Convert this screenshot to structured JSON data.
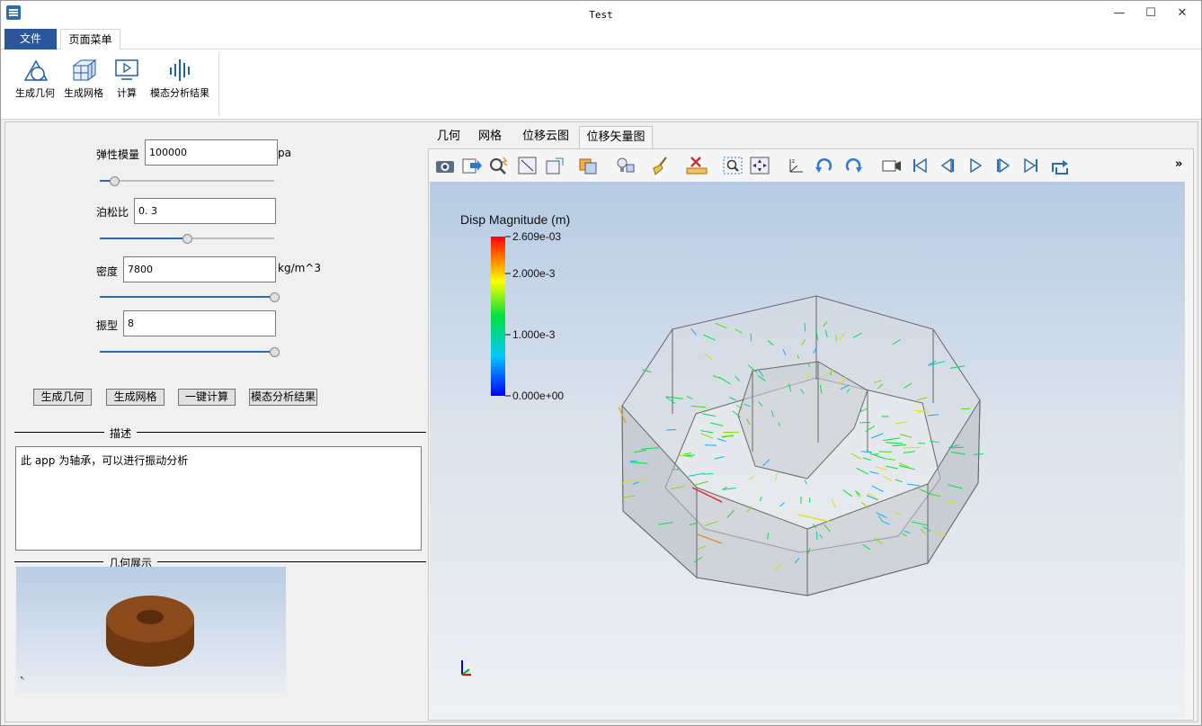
{
  "window": {
    "title": "Test",
    "minimize": "—",
    "maximize": "☐",
    "close": "✕"
  },
  "ribbon": {
    "tabs": [
      "文件",
      "页面菜单"
    ],
    "buttons": [
      "生成几何",
      "生成网格",
      "计算",
      "模态分析结果"
    ]
  },
  "params": {
    "elastic": {
      "label": "弹性模量",
      "value": "100000",
      "unit": "pa",
      "slider": 0.08
    },
    "poisson": {
      "label": "泊松比",
      "value": "0. 3",
      "slider": 0.5
    },
    "density": {
      "label": "密度",
      "value": "7800",
      "unit": "kg/m^3",
      "slider": 1.0
    },
    "mode": {
      "label": "振型",
      "value": "8",
      "slider": 1.0
    }
  },
  "actions": [
    "生成几何",
    "生成网格",
    "一键计算",
    "模态分析结果"
  ],
  "description": {
    "title": "描述",
    "text": "此 app 为轴承，可以进行振动分析"
  },
  "geometry_preview": {
    "title": "几何展示",
    "color": "#8a4a1a"
  },
  "view_tabs": [
    "几何",
    "网格",
    "位移云图",
    "位移矢量图"
  ],
  "active_view_tab": 3,
  "toolbar_more": "»",
  "colorbar": {
    "title": "Disp Magnitude (m)",
    "labels": [
      "2.609e-03",
      "2.000e-3",
      "1.000e-3",
      "0.000e+00"
    ]
  },
  "colors": {
    "accent": "#2b579a",
    "slider": "#2b6cb0"
  }
}
